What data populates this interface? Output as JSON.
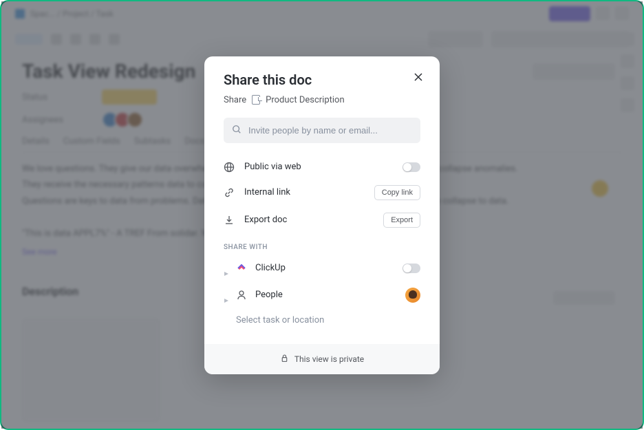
{
  "background": {
    "title": "Task View Redesign",
    "status_label": "Status",
    "assignees_label": "Assignees",
    "tabs": [
      "Details",
      "Custom Fields",
      "Subtasks",
      "Docs"
    ],
    "description_heading": "Description"
  },
  "modal": {
    "title": "Share this doc",
    "share_label": "Share",
    "doc_name": "Product Description",
    "search_placeholder": "Invite people by name or email...",
    "public_label": "Public via web",
    "internal_label": "Internal link",
    "copy_btn": "Copy link",
    "export_label": "Export doc",
    "export_btn": "Export",
    "share_with_label": "SHARE WITH",
    "clickup_label": "ClickUp",
    "people_label": "People",
    "select_task_label": "Select task or location",
    "footer_text": "This view is private"
  }
}
